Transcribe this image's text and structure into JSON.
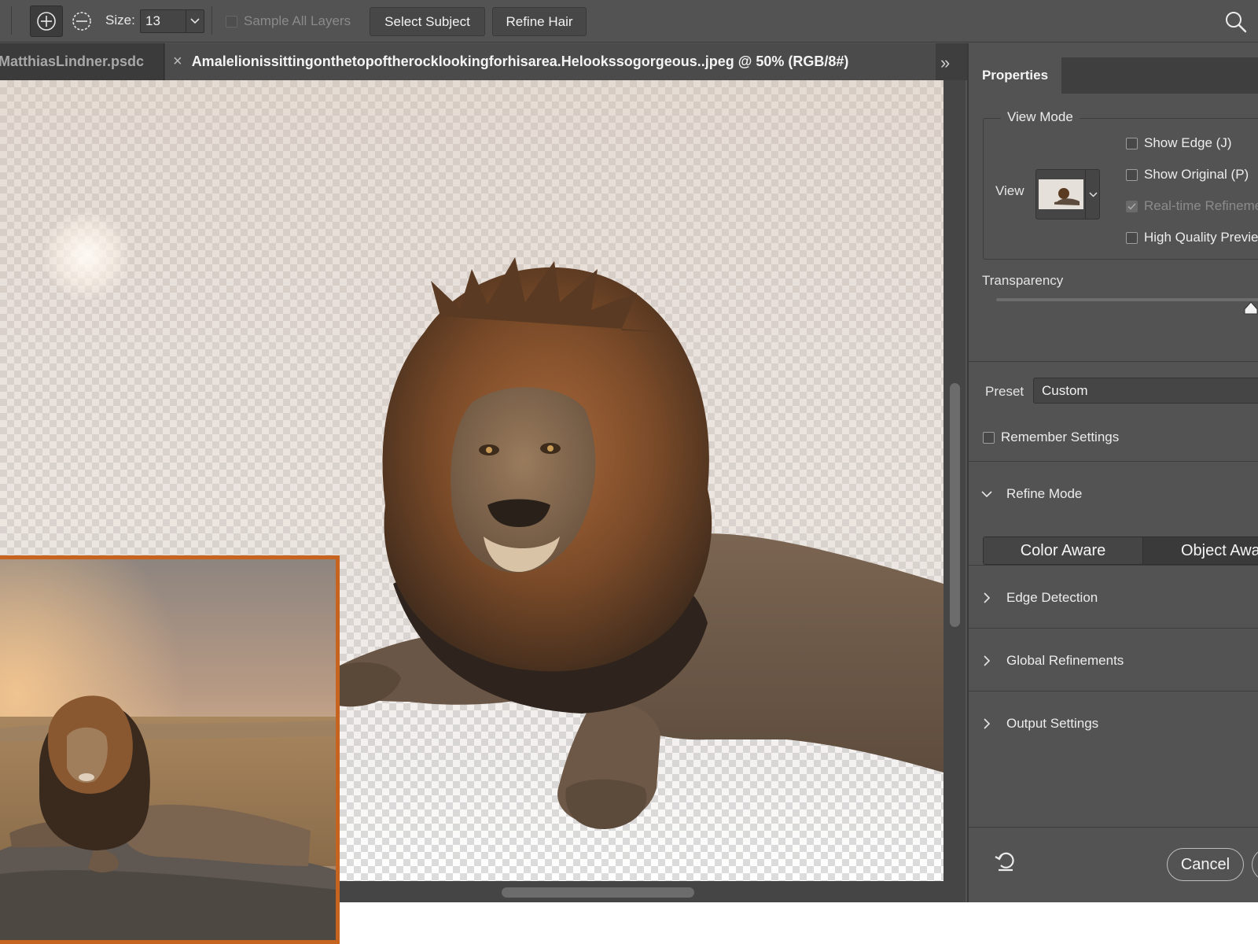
{
  "options_bar": {
    "size_label": "Size:",
    "size_value": "13",
    "sample_all_layers_label": "Sample All Layers",
    "sample_all_layers_checked": false,
    "select_subject_label": "Select Subject",
    "refine_hair_label": "Refine Hair",
    "icons": [
      "add-to-selection-icon",
      "subtract-from-selection-icon",
      "chevron-down-icon",
      "search-icon"
    ]
  },
  "tabs": [
    {
      "label": "MatthiasLindner.psdc",
      "active": false
    },
    {
      "label": "Amalelionissittingonthetopoftherocklookingforhisarea.Helookssogorgeous..jpeg @ 50% (RGB/8#)",
      "active": true,
      "close_glyph": "×"
    }
  ],
  "tab_overflow_glyph": "»",
  "properties": {
    "tab_label": "Properties",
    "view_mode": {
      "title": "View Mode",
      "view_label": "View",
      "checkboxes": [
        {
          "label": "Show Edge (J)",
          "checked": false,
          "disabled": false
        },
        {
          "label": "Show Original (P)",
          "checked": false,
          "disabled": false
        },
        {
          "label": "Real-time Refinement",
          "checked": true,
          "disabled": true
        },
        {
          "label": "High Quality Preview",
          "checked": false,
          "disabled": false
        }
      ]
    },
    "transparency": {
      "label": "Transparency",
      "value_percent": 90
    },
    "preset": {
      "label": "Preset",
      "value": "Custom"
    },
    "remember_settings": {
      "label": "Remember Settings",
      "checked": false
    },
    "refine_mode": {
      "label": "Refine Mode",
      "expanded": true,
      "options": [
        "Color Aware",
        "Object Aware"
      ],
      "selected": "Object Aware"
    },
    "sections": [
      {
        "label": "Edge Detection",
        "expanded": false
      },
      {
        "label": "Global Refinements",
        "expanded": false
      },
      {
        "label": "Output Settings",
        "expanded": false
      }
    ],
    "cancel_label": "Cancel",
    "reset_icon": "reset-icon"
  },
  "colors": {
    "app_bg": "#535353",
    "dark_bg": "#3e3e3e",
    "inset_border": "#c6631f"
  }
}
